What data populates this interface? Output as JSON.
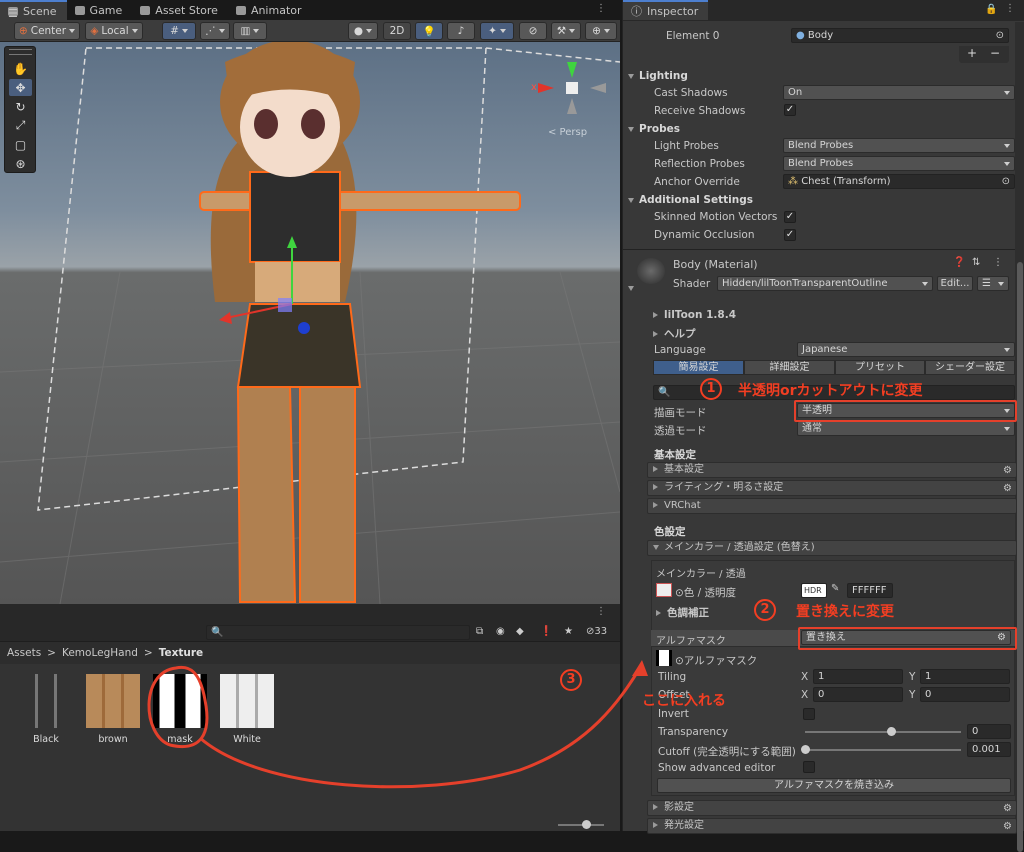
{
  "tabs": {
    "scene": "Scene",
    "game": "Game",
    "asset_store": "Asset Store",
    "animator": "Animator",
    "inspector": "Inspector"
  },
  "toolbar": {
    "pivot": "Center",
    "space": "Local",
    "mode_2d": "2D"
  },
  "scene": {
    "persp_label": "< Persp",
    "gizmo_x": "x"
  },
  "project": {
    "crumb_assets": "Assets",
    "crumb_folder": "KemoLegHand",
    "crumb_current": "Texture",
    "count": "33",
    "assets": [
      {
        "name": "Black"
      },
      {
        "name": "brown"
      },
      {
        "name": "mask"
      },
      {
        "name": "White"
      }
    ]
  },
  "inspector": {
    "element0_label": "Element 0",
    "element0_value": "Body",
    "lighting": "Lighting",
    "cast_shadows": "Cast Shadows",
    "cast_shadows_value": "On",
    "receive_shadows": "Receive Shadows",
    "probes": "Probes",
    "light_probes": "Light Probes",
    "light_probes_value": "Blend Probes",
    "reflection_probes": "Reflection Probes",
    "reflection_probes_value": "Blend Probes",
    "anchor_override": "Anchor Override",
    "anchor_override_value": "Chest (Transform)",
    "additional": "Additional Settings",
    "skinned_motion": "Skinned Motion Vectors",
    "dynamic_occlusion": "Dynamic Occlusion",
    "material_name": "Body (Material)",
    "shader_label": "Shader",
    "shader_value": "Hidden/lilToonTransparentOutline",
    "edit_button": "Edit...",
    "liltoon": "lilToon 1.8.4",
    "help": "ヘルプ",
    "language": "Language",
    "language_value": "Japanese",
    "tab_simple": "簡易設定",
    "tab_detail": "詳細設定",
    "tab_preset": "プリセット",
    "tab_shader": "シェーダー設定",
    "render_mode": "描画モード",
    "render_mode_value": "半透明",
    "transparent_mode": "透過モード",
    "transparent_mode_value": "通常",
    "basic_header": "基本設定",
    "basic_section": "基本設定",
    "lighting_section": "ライティング・明るさ設定",
    "vrchat_section": "VRChat",
    "color_header": "色設定",
    "main_color_section": "メインカラー / 透過設定 (色替え)",
    "main_color_sub": "メインカラー / 透過",
    "color_alpha": "⊙色 / 透明度",
    "hdr": "HDR",
    "color_hex": "FFFFFF",
    "tone": "色調補正",
    "alpha_mask": "アルファマスク",
    "alpha_mask_mode": "置き換え",
    "alpha_mask_tex": "⊙アルファマスク",
    "tiling": "Tiling",
    "tiling_x": "1",
    "tiling_y": "1",
    "offset": "Offset",
    "offset_x": "0",
    "offset_y": "0",
    "x_lbl": "X",
    "y_lbl": "Y",
    "invert": "Invert",
    "transparency": "Transparency",
    "transparency_value": "0",
    "transparency_level": 0.55,
    "cutoff": "Cutoff (完全透明にする範囲)",
    "cutoff_value": "0.001",
    "cutoff_level": 0.0,
    "show_advanced": "Show advanced editor",
    "bake_button": "アルファマスクを焼き込み",
    "shadow_section": "影設定",
    "emission_section": "発光設定"
  },
  "annotations": {
    "n1": "1",
    "t1": "半透明orカットアウトに変更",
    "n2": "2",
    "t2": "置き換えに変更",
    "n3": "3",
    "t3": "ここに入れる"
  }
}
